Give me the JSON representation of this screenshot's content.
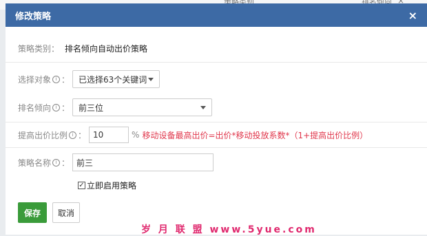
{
  "background": {
    "col1": "策略类别",
    "col2": "排名倾向",
    "close_glyph": "×"
  },
  "dialog": {
    "title": "修改策略",
    "close_glyph": "×"
  },
  "form": {
    "strategy_type": {
      "label": "策略类别：",
      "value": "排名倾向自动出价策略"
    },
    "target": {
      "label": "选择对象",
      "help_icon": "help-circle-icon",
      "colon": "：",
      "value": "已选择63个关键词"
    },
    "rank": {
      "label": "排名倾向",
      "help_icon": "help-circle-icon",
      "colon": "：",
      "value": "前三位"
    },
    "bid_ratio": {
      "label": "提高出价比例",
      "help_icon": "help-circle-icon",
      "colon": "：",
      "value": "10",
      "unit": "%",
      "formula": "移动设备最高出价=出价*移动投放系数*（1+提高出价比例）"
    },
    "name": {
      "label": "策略名称",
      "help_icon": "help-circle-icon",
      "colon": "：",
      "value": "前三"
    },
    "enable_checkbox": {
      "label": "立即启用策略",
      "checked": true
    }
  },
  "buttons": {
    "save": "保存",
    "cancel": "取消"
  },
  "watermark": "岁 月 联 盟  www.5yue.com",
  "colors": {
    "header": "#3d6aa5",
    "save": "#3a9b3a",
    "formula": "#e0364b",
    "watermark": "#e02a6f"
  }
}
